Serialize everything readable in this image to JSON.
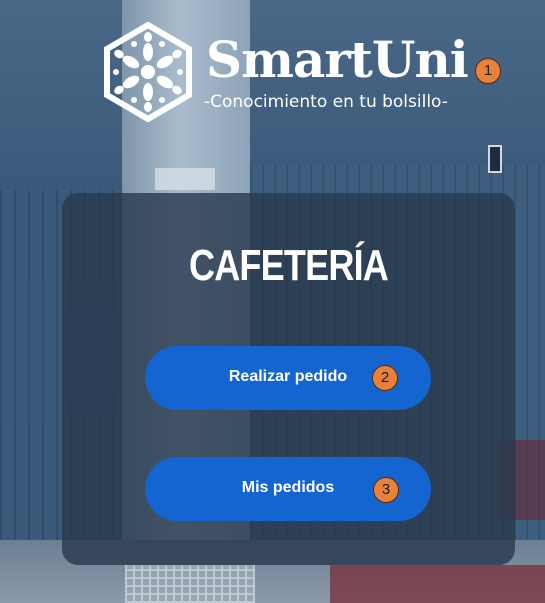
{
  "header": {
    "brand": "SmartUni",
    "tagline": "-Conocimiento en tu bolsillo-",
    "badge": "1"
  },
  "card": {
    "title": "CAFETERÍA",
    "buttons": [
      {
        "label": "Realizar pedido",
        "badge": "2"
      },
      {
        "label": "Mis pedidos",
        "badge": "3"
      }
    ]
  },
  "colors": {
    "button": "#1565d0",
    "badge": "#e8823a",
    "card": "#28384c"
  },
  "icons": [
    "mandala-logo-icon"
  ]
}
